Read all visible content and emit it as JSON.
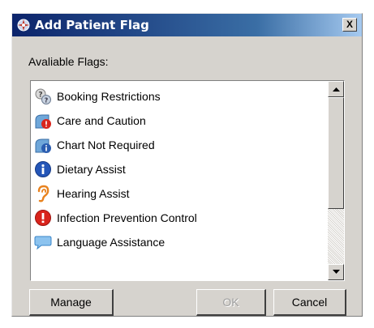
{
  "dialog": {
    "title": "Add Patient Flag",
    "close_label": "X",
    "available_label": "Avaliable Flags:"
  },
  "flags": [
    {
      "label": "Booking Restrictions",
      "icon": "booking-restrictions-icon"
    },
    {
      "label": "Care and Caution",
      "icon": "care-caution-icon"
    },
    {
      "label": "Chart Not Required",
      "icon": "chart-not-required-icon"
    },
    {
      "label": "Dietary Assist",
      "icon": "info-icon"
    },
    {
      "label": "Hearing Assist",
      "icon": "ear-icon"
    },
    {
      "label": "Infection Prevention Control",
      "icon": "alert-icon"
    },
    {
      "label": "Language Assistance",
      "icon": "speech-bubble-icon"
    }
  ],
  "buttons": {
    "manage": "Manage",
    "ok": "OK",
    "cancel": "Cancel"
  },
  "colors": {
    "titlebar_start": "#0c246b",
    "titlebar_end": "#a6caf0",
    "dialog_bg": "#d6d3ce",
    "disabled_text": "#a0a0a0"
  }
}
